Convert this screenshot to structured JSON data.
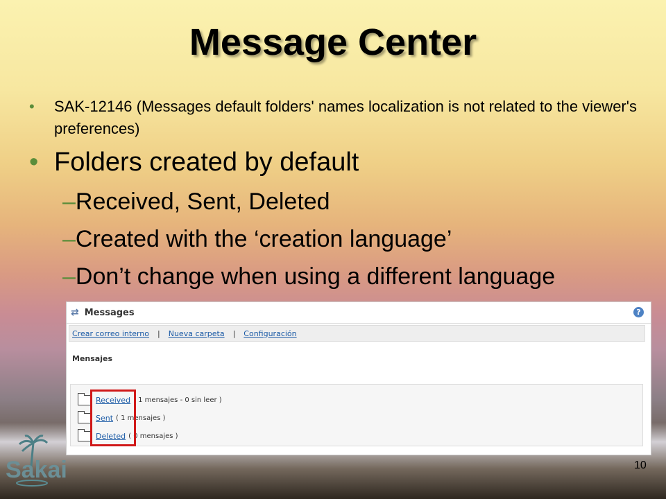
{
  "slide": {
    "title": "Message Center",
    "bullet_small": "SAK-12146 (Messages default folders' names localization is not related to the viewer's preferences)",
    "bullet_big": "Folders created by default",
    "subs": [
      "Received,  Sent, Deleted",
      "Created with the ‘creation language’",
      "Don’t change when using a different language"
    ],
    "dash": "–",
    "bullet_char": "•",
    "page_number": "10",
    "logo_text": "Sakai"
  },
  "panel": {
    "title": "Messages",
    "help": "?",
    "nav": [
      "Crear correo interno",
      "Nueva carpeta",
      "Configuración"
    ],
    "nav_sep": "|",
    "section": "Mensajes",
    "folders": [
      {
        "name": "Received",
        "info": "( 1 mensajes - 0 sin leer )"
      },
      {
        "name": "Sent",
        "info": "( 1 mensajes )"
      },
      {
        "name": "Deleted",
        "info": "( 0 mensajes )"
      }
    ]
  },
  "colors": {
    "bullet": "#5a8d3a",
    "link": "#1a5aa6",
    "highlight": "#d01818"
  }
}
